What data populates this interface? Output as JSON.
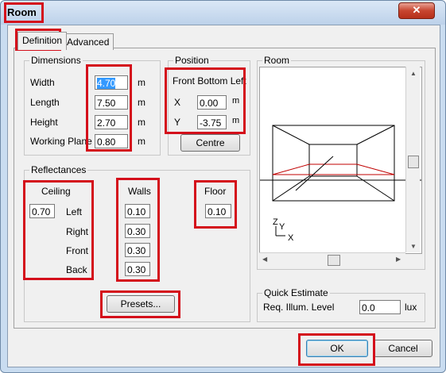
{
  "window": {
    "title": "Room",
    "close_glyph": "✕"
  },
  "tabs": [
    {
      "label": "Definition",
      "active": true
    },
    {
      "label": "Advanced",
      "active": false
    }
  ],
  "dimensions": {
    "title": "Dimensions",
    "fields": [
      {
        "label": "Width",
        "value": "4.70",
        "unit": "m",
        "selected": true
      },
      {
        "label": "Length",
        "value": "7.50",
        "unit": "m"
      },
      {
        "label": "Height",
        "value": "2.70",
        "unit": "m"
      },
      {
        "label": "Working Plane",
        "value": "0.80",
        "unit": "m"
      }
    ]
  },
  "position": {
    "title": "Position",
    "subtitle": "Front Bottom Left",
    "fields": [
      {
        "label": "X",
        "value": "0.00",
        "unit": "m"
      },
      {
        "label": "Y",
        "value": "-3.75",
        "unit": "m"
      }
    ],
    "centre_label": "Centre"
  },
  "room_preview": {
    "title": "Room",
    "axis_z": "Z",
    "axis_y": "Y",
    "axis_x": "X"
  },
  "reflectances": {
    "title": "Reflectances",
    "ceiling": {
      "label": "Ceiling",
      "value": "0.70"
    },
    "walls": {
      "label": "Walls",
      "labels": [
        "Left",
        "Right",
        "Front",
        "Back"
      ],
      "values": [
        "0.10",
        "0.30",
        "0.30",
        "0.30"
      ]
    },
    "floor": {
      "label": "Floor",
      "value": "0.10"
    },
    "presets_label": "Presets..."
  },
  "quick_estimate": {
    "title": "Quick Estimate",
    "label": "Req. Illum. Level",
    "value": "0.0",
    "unit": "lux"
  },
  "footer": {
    "ok_label": "OK",
    "cancel_label": "Cancel"
  },
  "colors": {
    "highlight": "#d40f1b",
    "selection": "#3399ff",
    "preview_floor_line": "#c00000"
  }
}
